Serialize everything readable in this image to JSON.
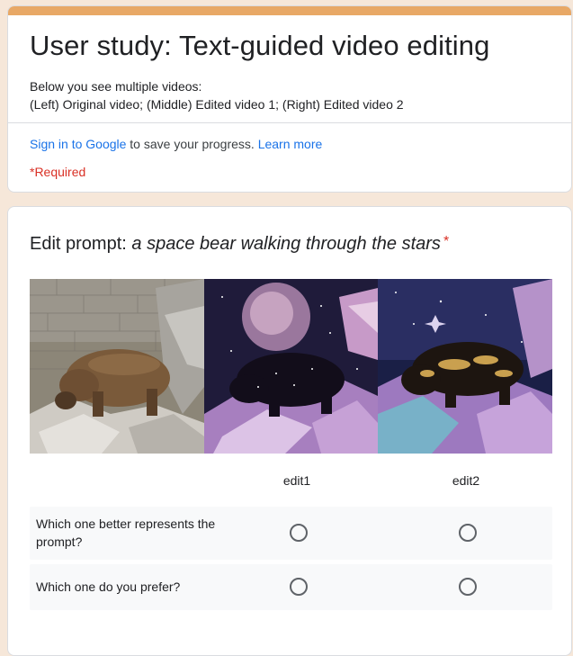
{
  "header": {
    "title": "User study: Text-guided video editing",
    "description_line1": "Below you see multiple videos:",
    "description_line2": "(Left) Original video; (Middle) Edited video 1; (Right) Edited video 2",
    "signin_link": "Sign in to Google",
    "signin_text": " to save your progress. ",
    "learn_more": "Learn more",
    "required_note": "*Required",
    "accent_color": "#e8a866"
  },
  "question": {
    "title_prefix": "Edit prompt: ",
    "prompt": "a space bear walking through the stars",
    "required_star": "*",
    "columns": [
      "edit1",
      "edit2"
    ],
    "rows": [
      "Which one better represents the prompt?",
      "Which one do you prefer?"
    ]
  },
  "colors": {
    "background": "#f6e7d9",
    "link": "#1a73e8",
    "required": "#d93025"
  }
}
